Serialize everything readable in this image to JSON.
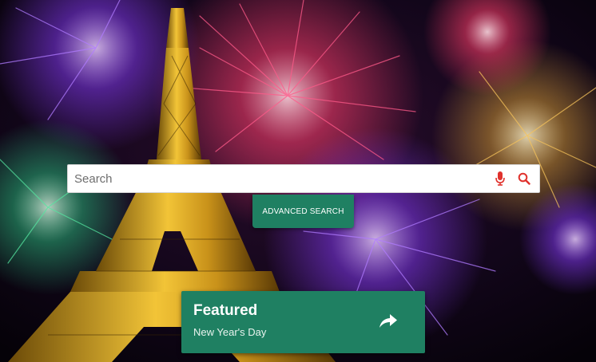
{
  "background": {
    "description_icon": "eiffel-tower-fireworks-photo"
  },
  "search": {
    "placeholder": "Search",
    "value": "",
    "mic_icon": "microphone-icon",
    "search_icon": "search-icon"
  },
  "advanced_search": {
    "label": "ADVANCED SEARCH"
  },
  "featured": {
    "title": "Featured",
    "subtitle": "New Year's Day",
    "icon": "share-arrow-icon"
  },
  "colors": {
    "accent": "#1f8062",
    "icon_red": "#e0322d"
  }
}
